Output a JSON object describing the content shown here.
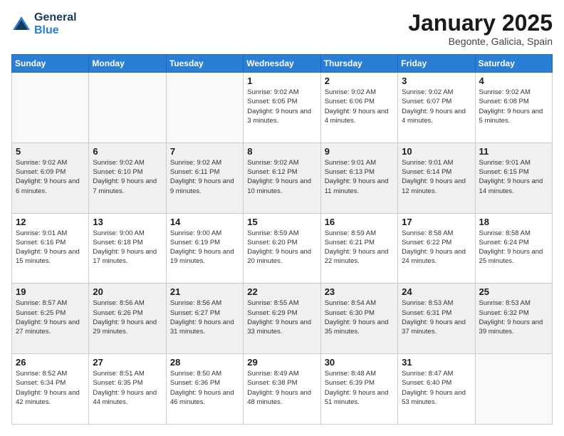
{
  "logo": {
    "line1": "General",
    "line2": "Blue"
  },
  "title": "January 2025",
  "location": "Begonte, Galicia, Spain",
  "weekdays": [
    "Sunday",
    "Monday",
    "Tuesday",
    "Wednesday",
    "Thursday",
    "Friday",
    "Saturday"
  ],
  "weeks": [
    [
      {
        "day": "",
        "info": ""
      },
      {
        "day": "",
        "info": ""
      },
      {
        "day": "",
        "info": ""
      },
      {
        "day": "1",
        "info": "Sunrise: 9:02 AM\nSunset: 6:05 PM\nDaylight: 9 hours and 3 minutes."
      },
      {
        "day": "2",
        "info": "Sunrise: 9:02 AM\nSunset: 6:06 PM\nDaylight: 9 hours and 4 minutes."
      },
      {
        "day": "3",
        "info": "Sunrise: 9:02 AM\nSunset: 6:07 PM\nDaylight: 9 hours and 4 minutes."
      },
      {
        "day": "4",
        "info": "Sunrise: 9:02 AM\nSunset: 6:08 PM\nDaylight: 9 hours and 5 minutes."
      }
    ],
    [
      {
        "day": "5",
        "info": "Sunrise: 9:02 AM\nSunset: 6:09 PM\nDaylight: 9 hours and 6 minutes."
      },
      {
        "day": "6",
        "info": "Sunrise: 9:02 AM\nSunset: 6:10 PM\nDaylight: 9 hours and 7 minutes."
      },
      {
        "day": "7",
        "info": "Sunrise: 9:02 AM\nSunset: 6:11 PM\nDaylight: 9 hours and 9 minutes."
      },
      {
        "day": "8",
        "info": "Sunrise: 9:02 AM\nSunset: 6:12 PM\nDaylight: 9 hours and 10 minutes."
      },
      {
        "day": "9",
        "info": "Sunrise: 9:01 AM\nSunset: 6:13 PM\nDaylight: 9 hours and 11 minutes."
      },
      {
        "day": "10",
        "info": "Sunrise: 9:01 AM\nSunset: 6:14 PM\nDaylight: 9 hours and 12 minutes."
      },
      {
        "day": "11",
        "info": "Sunrise: 9:01 AM\nSunset: 6:15 PM\nDaylight: 9 hours and 14 minutes."
      }
    ],
    [
      {
        "day": "12",
        "info": "Sunrise: 9:01 AM\nSunset: 6:16 PM\nDaylight: 9 hours and 15 minutes."
      },
      {
        "day": "13",
        "info": "Sunrise: 9:00 AM\nSunset: 6:18 PM\nDaylight: 9 hours and 17 minutes."
      },
      {
        "day": "14",
        "info": "Sunrise: 9:00 AM\nSunset: 6:19 PM\nDaylight: 9 hours and 19 minutes."
      },
      {
        "day": "15",
        "info": "Sunrise: 8:59 AM\nSunset: 6:20 PM\nDaylight: 9 hours and 20 minutes."
      },
      {
        "day": "16",
        "info": "Sunrise: 8:59 AM\nSunset: 6:21 PM\nDaylight: 9 hours and 22 minutes."
      },
      {
        "day": "17",
        "info": "Sunrise: 8:58 AM\nSunset: 6:22 PM\nDaylight: 9 hours and 24 minutes."
      },
      {
        "day": "18",
        "info": "Sunrise: 8:58 AM\nSunset: 6:24 PM\nDaylight: 9 hours and 25 minutes."
      }
    ],
    [
      {
        "day": "19",
        "info": "Sunrise: 8:57 AM\nSunset: 6:25 PM\nDaylight: 9 hours and 27 minutes."
      },
      {
        "day": "20",
        "info": "Sunrise: 8:56 AM\nSunset: 6:26 PM\nDaylight: 9 hours and 29 minutes."
      },
      {
        "day": "21",
        "info": "Sunrise: 8:56 AM\nSunset: 6:27 PM\nDaylight: 9 hours and 31 minutes."
      },
      {
        "day": "22",
        "info": "Sunrise: 8:55 AM\nSunset: 6:29 PM\nDaylight: 9 hours and 33 minutes."
      },
      {
        "day": "23",
        "info": "Sunrise: 8:54 AM\nSunset: 6:30 PM\nDaylight: 9 hours and 35 minutes."
      },
      {
        "day": "24",
        "info": "Sunrise: 8:53 AM\nSunset: 6:31 PM\nDaylight: 9 hours and 37 minutes."
      },
      {
        "day": "25",
        "info": "Sunrise: 8:53 AM\nSunset: 6:32 PM\nDaylight: 9 hours and 39 minutes."
      }
    ],
    [
      {
        "day": "26",
        "info": "Sunrise: 8:52 AM\nSunset: 6:34 PM\nDaylight: 9 hours and 42 minutes."
      },
      {
        "day": "27",
        "info": "Sunrise: 8:51 AM\nSunset: 6:35 PM\nDaylight: 9 hours and 44 minutes."
      },
      {
        "day": "28",
        "info": "Sunrise: 8:50 AM\nSunset: 6:36 PM\nDaylight: 9 hours and 46 minutes."
      },
      {
        "day": "29",
        "info": "Sunrise: 8:49 AM\nSunset: 6:38 PM\nDaylight: 9 hours and 48 minutes."
      },
      {
        "day": "30",
        "info": "Sunrise: 8:48 AM\nSunset: 6:39 PM\nDaylight: 9 hours and 51 minutes."
      },
      {
        "day": "31",
        "info": "Sunrise: 8:47 AM\nSunset: 6:40 PM\nDaylight: 9 hours and 53 minutes."
      },
      {
        "day": "",
        "info": ""
      }
    ]
  ]
}
